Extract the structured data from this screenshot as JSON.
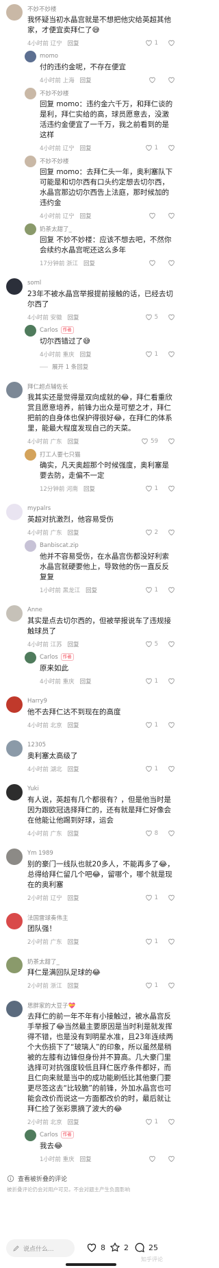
{
  "colors": {
    "accent_red": "#f2404f",
    "meta_gray": "#a3a3a3",
    "text": "#1f1f1f"
  },
  "comments": [
    {
      "user": "不妙不妙楼",
      "text": "我怀疑当初水晶宫就是不想把他灾给英超其他家，才便宜卖拜仁了😅",
      "time": "4小时前",
      "loc": "辽宁",
      "likes": "1",
      "reply": false,
      "avatar": "#c9b8a6"
    },
    {
      "user": "momo",
      "text": "付的违约金呢，不存在便宜",
      "time": "4小时前",
      "loc": "上海",
      "likes": "",
      "reply": true,
      "avatar": "#5c6f91"
    },
    {
      "user": "不妙不妙楼",
      "text": "回复 momo：违约金六千万，和拜仁谈的是利，拜仁实给的高，球员愿意去，没激活违约金便宜了一千万，我之前看到的是这样",
      "time": "4小时前",
      "loc": "辽宁",
      "likes": "1",
      "reply": true,
      "avatar": "#c9b8a6"
    },
    {
      "user": "不妙不妙楼",
      "text": "回复 momo：去拜仁头一年，奥利塞队下可能是和切尔西有口头约定想去切尔西，水晶宫那边切尔西告上法庭，那时候加的违约金",
      "time": "4小时前",
      "loc": "辽宁",
      "likes": "",
      "reply": true,
      "avatar": "#c9b8a6"
    },
    {
      "user": "奶茶太甜了_",
      "text": "回复 不妙不妙楼：应该不想去吧，不然你会续约水晶宫呢还这么多年",
      "time": "17分钟前",
      "loc": "浙江",
      "likes": "",
      "reply": true,
      "avatar": "#8a9a6b"
    },
    {
      "user": "soml",
      "text": "23年不被水晶宫举报提前接触的话，已经去切尔西了",
      "time": "4小时前",
      "loc": "安徽",
      "likes": "5",
      "reply": false,
      "avatar": "#2b2f3a"
    },
    {
      "user": "Carlos",
      "badge": "作者",
      "text": "切尔西错过了😅",
      "time": "4小时前",
      "loc": "重庆",
      "likes": "1",
      "reply": true,
      "avatar": "#4f7b5c"
    },
    {
      "user": "拜仁超点辅佐长",
      "text": "我其实还是觉得是双向成就的😂，拜仁看重欣赏且愿意培养，前锋力出众是可塑之才，拜仁把前的自身体也保护得很好😂，在拜仁的体系里，能最大程度发现自己的天菜。",
      "time": "4小时前",
      "loc": "广东",
      "likes": "59",
      "reply": false,
      "avatar": "#7c8896"
    },
    {
      "user": "打工人要七只猫",
      "text": "确实，凡天奥超那个时候强度，奥利塞是要去防，走偏不一定",
      "time": "12分钟前",
      "loc": "河南",
      "likes": "1",
      "reply": true,
      "avatar": "#d4a35b"
    },
    {
      "user": "mypalrs",
      "text": "英超对抗激烈，他容易受伤",
      "time": "4小时前",
      "loc": "广东",
      "likes": "2",
      "reply": false,
      "avatar": "#e9e4f1"
    },
    {
      "user": "Banbiscat.zip",
      "text": "他并不容易受伤，在水晶宫伤都没好利索水晶宫就硬要他上，导致他的伤一直反反复复",
      "time": "1小时前",
      "loc": "黑龙江",
      "likes": "1",
      "reply": true,
      "avatar": "#c7c2d6"
    },
    {
      "user": "Anne",
      "text": "其实是点去切尔西的，但被举报说车了违规接触球员了",
      "time": "4小时前",
      "loc": "江苏",
      "likes": "5",
      "reply": false,
      "avatar": "#c6c1b8"
    },
    {
      "user": "Carlos",
      "badge": "作者",
      "text": "原来如此",
      "time": "4小时前",
      "loc": "重庆",
      "likes": "1",
      "reply": true,
      "avatar": "#4f7b5c"
    },
    {
      "user": "Harry9",
      "text": "他不去拜仁达不到现在的高度",
      "time": "4小时前",
      "loc": "北京",
      "likes": "1",
      "reply": false,
      "avatar": "#c0392b"
    },
    {
      "user": "12305",
      "text": "奥利塞太高级了",
      "time": "4小时前",
      "loc": "湖北",
      "likes": "1",
      "reply": false,
      "avatar": "#8b9aa8"
    },
    {
      "user": "Yuki",
      "text": "有人说，英超有几个都很有？，但是他当时是因为跟欧冠选择拜仁的，还有就是拜仁好像会在他能让他踢到好球，运会",
      "time": "4小时前",
      "loc": "广东",
      "likes": "8",
      "reply": false,
      "avatar": "#2d2d2d"
    },
    {
      "user": "Ym 1989",
      "text": "别的豪门一线队也就20多人，不能再多了😂，总得给拜仁留几个吧😂，留哪个，哪个就是现在的奥利塞",
      "time": "2小时前",
      "loc": "辽宁",
      "likes": "1",
      "reply": false,
      "avatar": "#8c8a86"
    },
    {
      "user": "法国雷球奏伟主",
      "text": "团队强！",
      "time": "2小时前",
      "loc": "广东",
      "likes": "1",
      "reply": false,
      "avatar": "#d94a4a"
    },
    {
      "user": "奶茶太甜了_",
      "text": "拜仁是满回队足球的😂",
      "time": "2小时前",
      "loc": "浙江",
      "likes": "1",
      "reply": false,
      "avatar": "#8a9a6b"
    },
    {
      "user": "思胖家的大豆子💝",
      "text": "去拜仁的前一年不年有小接触过，被水晶宫反手举报了😂当然最主要原因是当时利是就发挥得不错，也是没有到明星水准，且23年连续两个大伤损下了“玻璃人”的印象，所以虽然是稍被的左膝有边锋但身份并不算高。几大豪门里选择可对抗强度较低且拜仁医疗条件都好，而且仁向来就是当中的成功能刷低比其他豪门要更尽签这去“比较脆”的前锋，外加水晶宫也可能会改价而说这一方面都改价的时，最后就让拜仁捡了张彩票摘了波大的😂",
      "time": "2小时前",
      "loc": "北京",
      "likes": "1",
      "reply": false,
      "avatar": "#5b6b7e"
    },
    {
      "user": "Carlos",
      "badge": "作者",
      "text": "我去😂",
      "time": "1小时前",
      "loc": "重庆",
      "likes": "",
      "reply": true,
      "avatar": "#4f7b5c"
    }
  ],
  "labels": {
    "reply": "回复",
    "expand": "展开 1 条回复",
    "fold": "查看被折叠的评论",
    "hint": "被折叠评论仍会对用户可见，不会对题主产生负面影响"
  },
  "bottom_bar": {
    "input_placeholder": "说点什么...",
    "likes_count": "8",
    "stars_count": "2",
    "comments_count": "25",
    "watermark": "知乎评论"
  }
}
